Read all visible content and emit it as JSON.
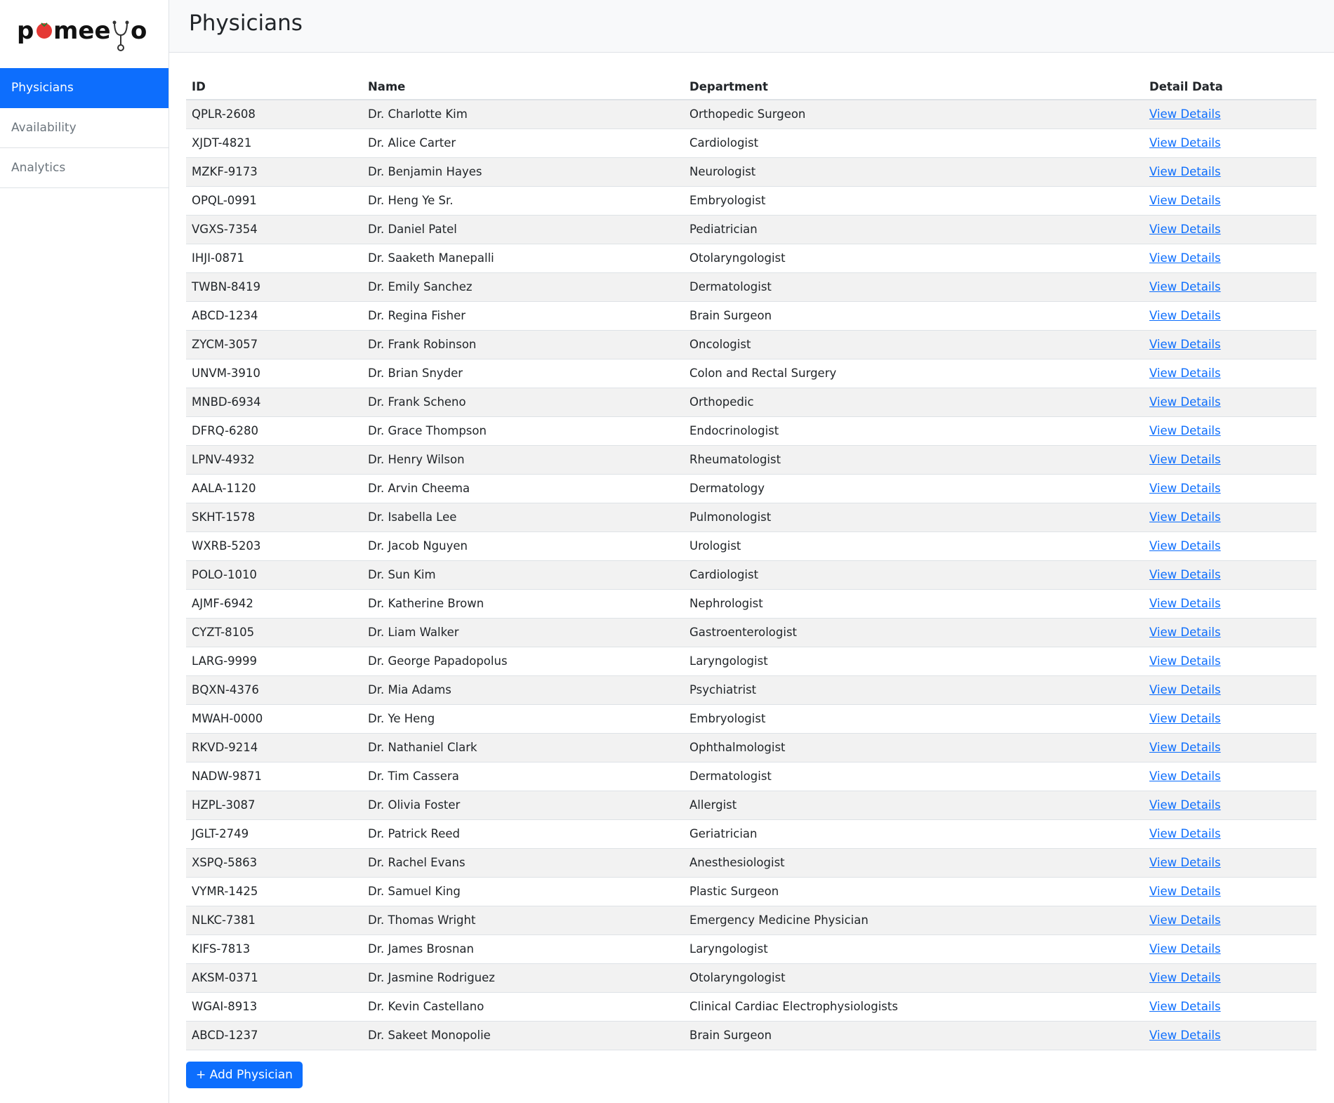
{
  "app": {
    "logo_text": "pomeeyo"
  },
  "sidebar": {
    "items": [
      {
        "label": "Physicians",
        "active": true
      },
      {
        "label": "Availability",
        "active": false
      },
      {
        "label": "Analytics",
        "active": false
      }
    ]
  },
  "header": {
    "title": "Physicians"
  },
  "table": {
    "columns": [
      "ID",
      "Name",
      "Department",
      "Detail Data"
    ],
    "link_label": "View Details",
    "rows": [
      {
        "id": "QPLR-2608",
        "name": "Dr. Charlotte Kim",
        "department": "Orthopedic Surgeon"
      },
      {
        "id": "XJDT-4821",
        "name": "Dr. Alice Carter",
        "department": "Cardiologist"
      },
      {
        "id": "MZKF-9173",
        "name": "Dr. Benjamin Hayes",
        "department": "Neurologist"
      },
      {
        "id": "OPQL-0991",
        "name": "Dr. Heng Ye Sr.",
        "department": "Embryologist"
      },
      {
        "id": "VGXS-7354",
        "name": "Dr. Daniel Patel",
        "department": "Pediatrician"
      },
      {
        "id": "IHJI-0871",
        "name": "Dr. Saaketh Manepalli",
        "department": "Otolaryngologist"
      },
      {
        "id": "TWBN-8419",
        "name": "Dr. Emily Sanchez",
        "department": "Dermatologist"
      },
      {
        "id": "ABCD-1234",
        "name": "Dr. Regina Fisher",
        "department": "Brain Surgeon"
      },
      {
        "id": "ZYCM-3057",
        "name": "Dr. Frank Robinson",
        "department": "Oncologist"
      },
      {
        "id": "UNVM-3910",
        "name": "Dr. Brian Snyder",
        "department": "Colon and Rectal Surgery"
      },
      {
        "id": "MNBD-6934",
        "name": "Dr. Frank Scheno",
        "department": "Orthopedic"
      },
      {
        "id": "DFRQ-6280",
        "name": "Dr. Grace Thompson",
        "department": "Endocrinologist"
      },
      {
        "id": "LPNV-4932",
        "name": "Dr. Henry Wilson",
        "department": "Rheumatologist"
      },
      {
        "id": "AALA-1120",
        "name": "Dr. Arvin Cheema",
        "department": "Dermatology"
      },
      {
        "id": "SKHT-1578",
        "name": "Dr. Isabella Lee",
        "department": "Pulmonologist"
      },
      {
        "id": "WXRB-5203",
        "name": "Dr. Jacob Nguyen",
        "department": "Urologist"
      },
      {
        "id": "POLO-1010",
        "name": "Dr. Sun Kim",
        "department": "Cardiologist"
      },
      {
        "id": "AJMF-6942",
        "name": "Dr. Katherine Brown",
        "department": "Nephrologist"
      },
      {
        "id": "CYZT-8105",
        "name": "Dr. Liam Walker",
        "department": "Gastroenterologist"
      },
      {
        "id": "LARG-9999",
        "name": "Dr. George Papadopolus",
        "department": "Laryngologist"
      },
      {
        "id": "BQXN-4376",
        "name": "Dr. Mia Adams",
        "department": "Psychiatrist"
      },
      {
        "id": "MWAH-0000",
        "name": "Dr. Ye Heng",
        "department": "Embryologist"
      },
      {
        "id": "RKVD-9214",
        "name": "Dr. Nathaniel Clark",
        "department": "Ophthalmologist"
      },
      {
        "id": "NADW-9871",
        "name": "Dr. Tim Cassera",
        "department": "Dermatologist"
      },
      {
        "id": "HZPL-3087",
        "name": "Dr. Olivia Foster",
        "department": "Allergist"
      },
      {
        "id": "JGLT-2749",
        "name": "Dr. Patrick Reed",
        "department": "Geriatrician"
      },
      {
        "id": "XSPQ-5863",
        "name": "Dr. Rachel Evans",
        "department": "Anesthesiologist"
      },
      {
        "id": "VYMR-1425",
        "name": "Dr. Samuel King",
        "department": "Plastic Surgeon"
      },
      {
        "id": "NLKC-7381",
        "name": "Dr. Thomas Wright",
        "department": "Emergency Medicine Physician"
      },
      {
        "id": "KIFS-7813",
        "name": "Dr. James Brosnan",
        "department": "Laryngologist"
      },
      {
        "id": "AKSM-0371",
        "name": "Dr. Jasmine Rodriguez",
        "department": "Otolaryngologist"
      },
      {
        "id": "WGAI-8913",
        "name": "Dr. Kevin Castellano",
        "department": "Clinical Cardiac Electrophysiologists"
      },
      {
        "id": "ABCD-1237",
        "name": "Dr. Sakeet Monopolie",
        "department": "Brain Surgeon"
      }
    ]
  },
  "actions": {
    "add_label": "+ Add Physician"
  },
  "colors": {
    "accent": "#0d6efd",
    "stripe": "#f2f2f2",
    "logo_dot": "#e53935"
  }
}
